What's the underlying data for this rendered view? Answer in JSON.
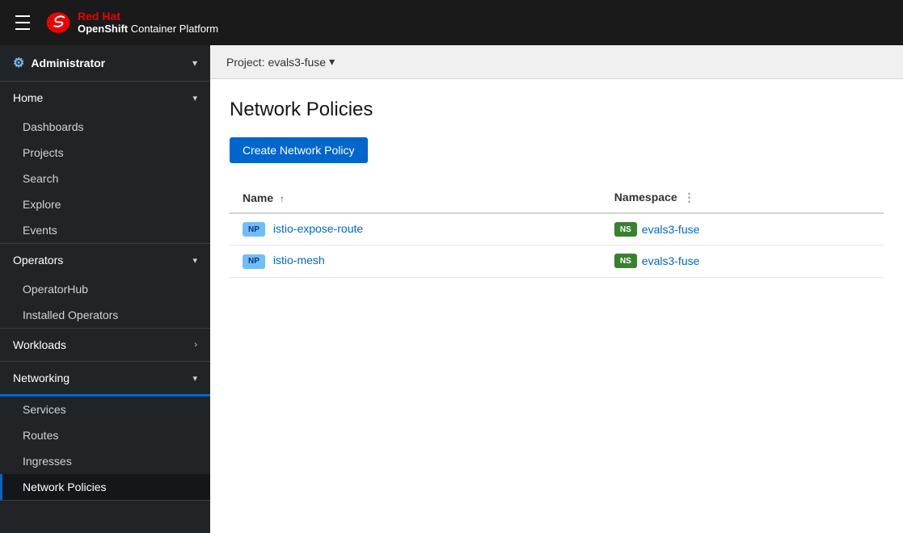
{
  "topbar": {
    "brand_main": "Red Hat",
    "brand_sub_bold": "OpenShift",
    "brand_sub_light": " Container Platform"
  },
  "sidebar": {
    "admin_label": "Administrator",
    "sections": [
      {
        "label": "Home",
        "expanded": true,
        "items": [
          "Dashboards",
          "Projects",
          "Search",
          "Explore",
          "Events"
        ]
      },
      {
        "label": "Operators",
        "expanded": true,
        "items": [
          "OperatorHub",
          "Installed Operators"
        ]
      },
      {
        "label": "Workloads",
        "expanded": false,
        "items": []
      },
      {
        "label": "Networking",
        "expanded": true,
        "items": [
          "Services",
          "Routes",
          "Ingresses",
          "Network Policies"
        ]
      }
    ]
  },
  "project_bar": {
    "label": "Project:",
    "project_name": "evals3-fuse"
  },
  "page": {
    "title": "Network Policies",
    "create_button": "Create Network Policy"
  },
  "table": {
    "columns": [
      {
        "label": "Name",
        "sort": true
      },
      {
        "label": "Namespace",
        "filter": true
      }
    ],
    "rows": [
      {
        "name_badge": "NP",
        "name": "istio-expose-route",
        "ns_badge": "NS",
        "namespace": "evals3-fuse"
      },
      {
        "name_badge": "NP",
        "name": "istio-mesh",
        "ns_badge": "NS",
        "namespace": "evals3-fuse"
      }
    ]
  }
}
